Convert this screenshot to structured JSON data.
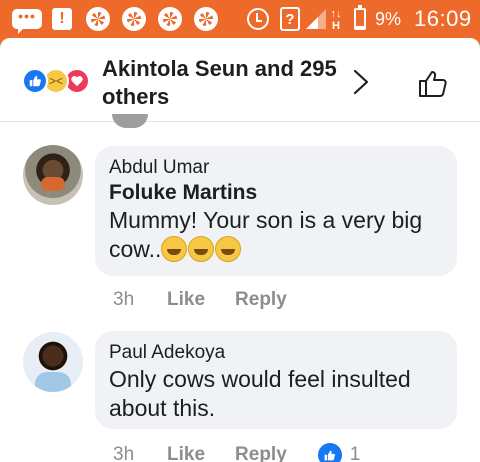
{
  "status_bar": {
    "battery_percent": "9%",
    "time": "16:09",
    "network_type": "H",
    "battery_level": 0.09,
    "icons": [
      "message-icon",
      "warning-icon",
      "app-icon",
      "app-icon",
      "app-icon",
      "app-icon",
      "alarm-icon",
      "question-icon",
      "signal-icon",
      "data-arrows-icon",
      "battery-icon"
    ]
  },
  "reactions": {
    "summary": "Akintola Seun and 295 others",
    "types": [
      "like",
      "haha",
      "love"
    ]
  },
  "comments": [
    {
      "author": "Abdul Umar",
      "mention": "Foluke Martins",
      "text": "Mummy! Your son is a very big cow..",
      "emojis": [
        "sweat-smile-emoji",
        "grinning-squint-emoji",
        "smiling-eyes-emoji"
      ],
      "time": "3h",
      "like_label": "Like",
      "reply_label": "Reply"
    },
    {
      "author": "Paul Adekoya",
      "text": "Only cows would feel insulted about this.",
      "time": "3h",
      "like_label": "Like",
      "reply_label": "Reply",
      "like_count": "1"
    }
  ],
  "colors": {
    "status_bar": "#ee6a2a",
    "like_blue": "#1877f2",
    "love_red": "#f0385a",
    "haha_yellow": "#f7c844",
    "bubble": "#f0f2f5",
    "meta_gray": "#8a8d91"
  }
}
